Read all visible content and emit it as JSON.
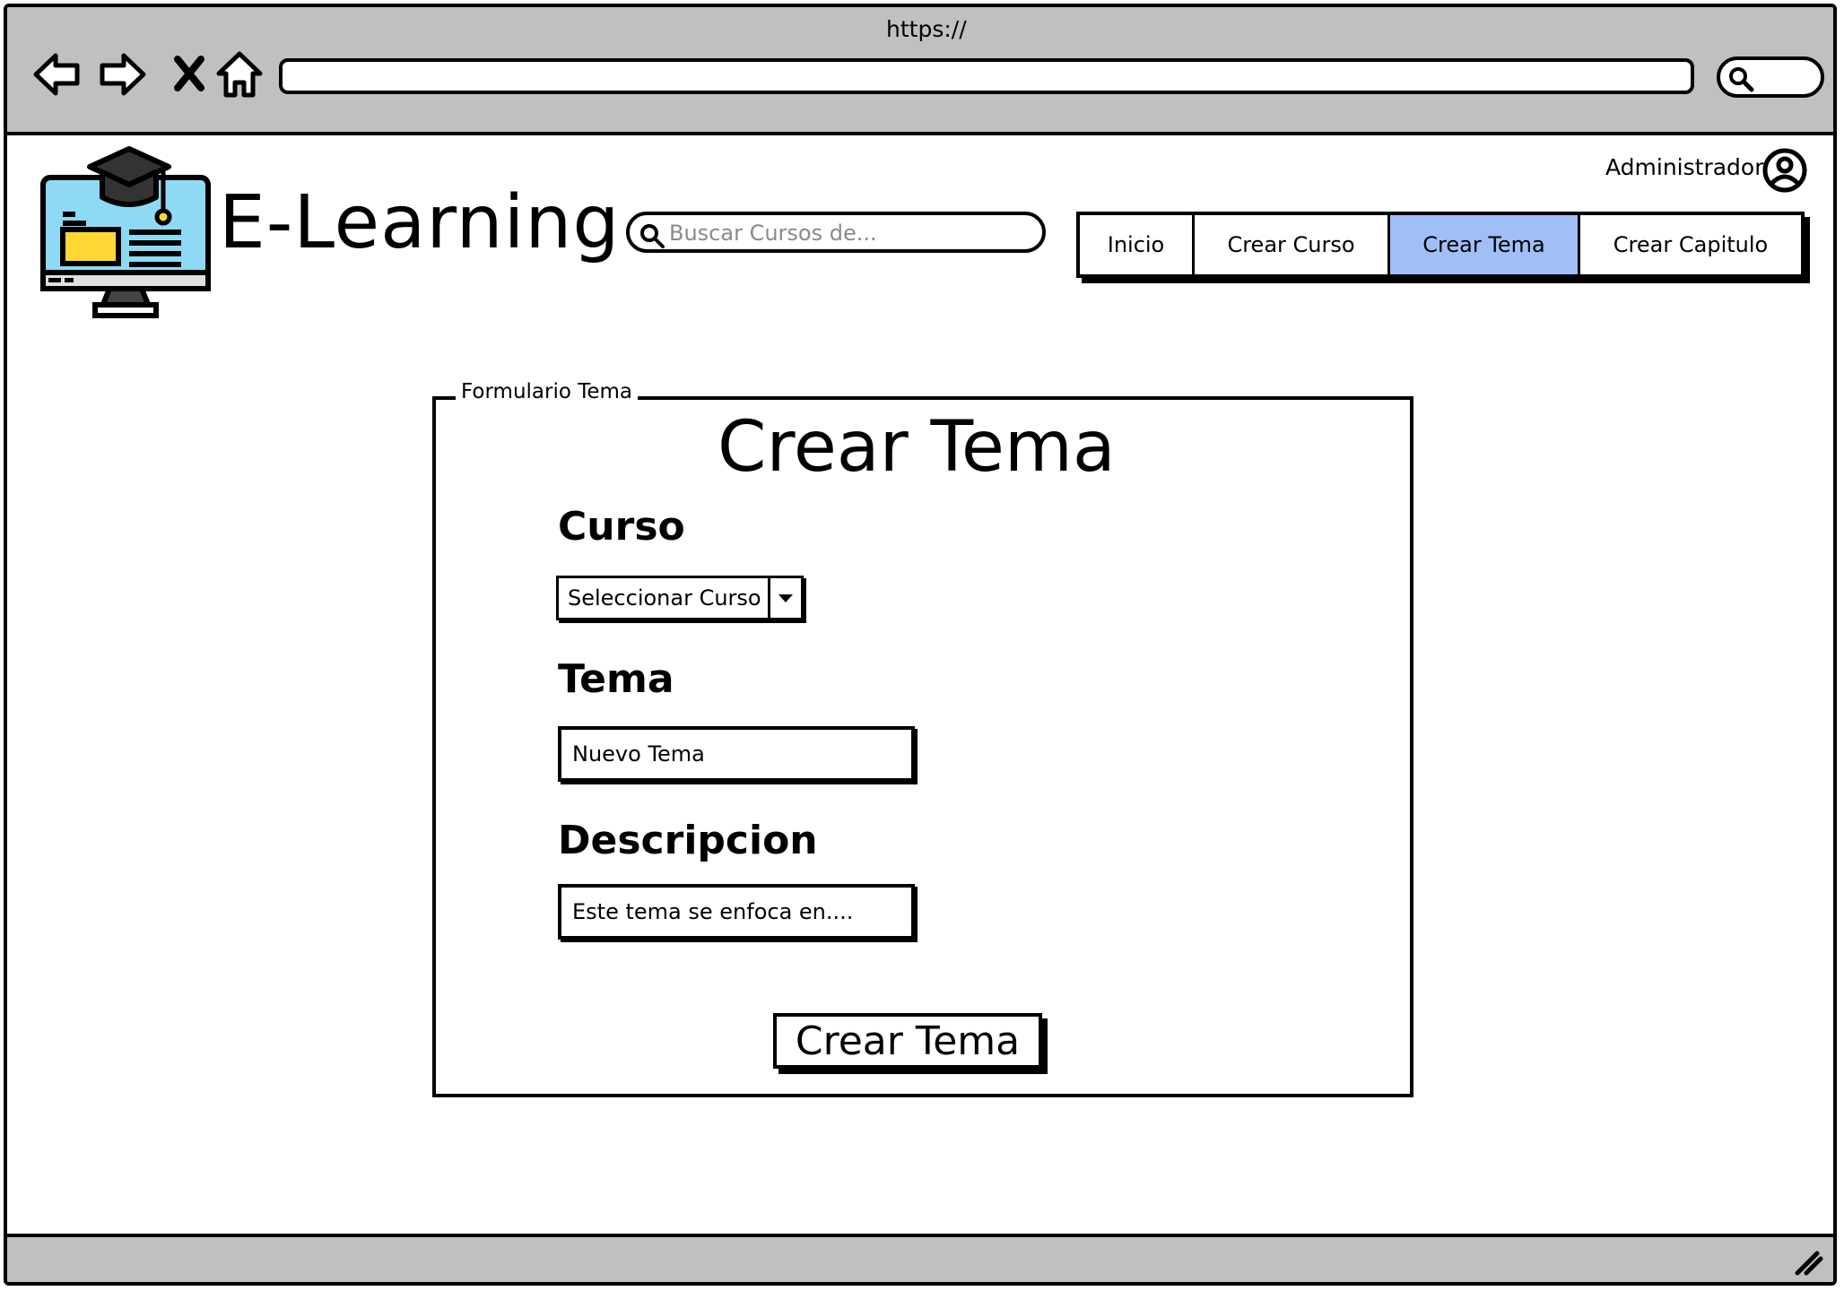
{
  "browser": {
    "url_label": "https://",
    "icons": [
      "back-icon",
      "forward-icon",
      "close-icon",
      "home-icon",
      "search-icon"
    ]
  },
  "header": {
    "brand": "E-Learning",
    "search_placeholder": "Buscar Cursos de...",
    "user_label": "Administrador"
  },
  "nav": {
    "tabs": [
      {
        "label": "Inicio",
        "active": false
      },
      {
        "label": "Crear Curso",
        "active": false
      },
      {
        "label": "Crear Tema",
        "active": true
      },
      {
        "label": "Crear Capitulo",
        "active": false
      }
    ],
    "active_color": "#a0bff6"
  },
  "form": {
    "legend": "Formulario Tema",
    "title": "Crear Tema",
    "curso_label": "Curso",
    "curso_select": "Seleccionar Curso",
    "tema_label": "Tema",
    "tema_placeholder": "Nuevo Tema",
    "descripcion_label": "Descripcion",
    "descripcion_placeholder": "Este tema se enfoca en....",
    "submit_label": "Crear Tema"
  },
  "colors": {
    "chrome": "#c0c0c0",
    "logo_screen": "#8edaf4",
    "logo_card": "#fdd835"
  }
}
